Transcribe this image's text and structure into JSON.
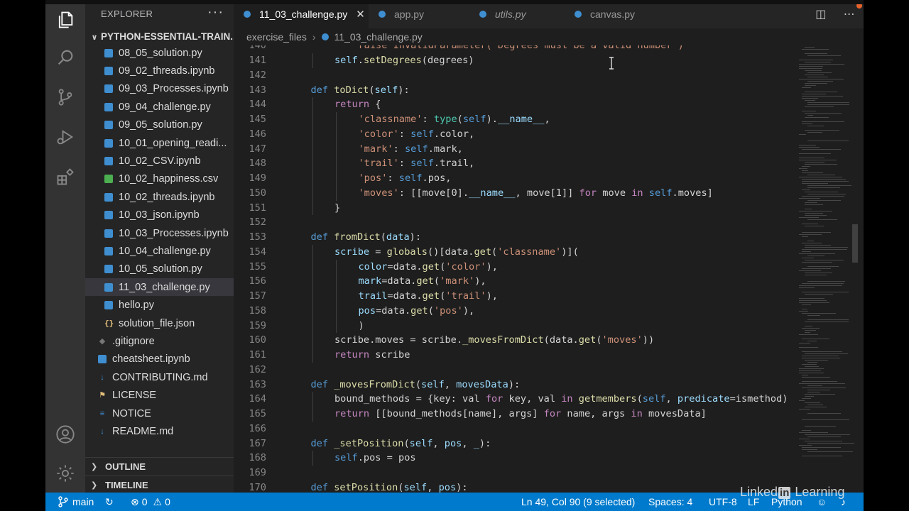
{
  "sidebar": {
    "title": "EXPLORER",
    "more": "···",
    "folder": "PYTHON-ESSENTIAL-TRAIN...",
    "files": [
      {
        "name": "08_05_solution.py",
        "icon": "python-file-icon",
        "level": 1
      },
      {
        "name": "09_02_threads.ipynb",
        "icon": "notebook-file-icon",
        "level": 1
      },
      {
        "name": "09_03_Processes.ipynb",
        "icon": "notebook-file-icon",
        "level": 1
      },
      {
        "name": "09_04_challenge.py",
        "icon": "python-file-icon",
        "level": 1
      },
      {
        "name": "09_05_solution.py",
        "icon": "python-file-icon",
        "level": 1
      },
      {
        "name": "10_01_opening_readi...",
        "icon": "python-file-icon",
        "level": 1
      },
      {
        "name": "10_02_CSV.ipynb",
        "icon": "notebook-file-icon",
        "level": 1
      },
      {
        "name": "10_02_happiness.csv",
        "icon": "csv-file-icon",
        "level": 1
      },
      {
        "name": "10_02_threads.ipynb",
        "icon": "notebook-file-icon",
        "level": 1
      },
      {
        "name": "10_03_json.ipynb",
        "icon": "notebook-file-icon",
        "level": 1
      },
      {
        "name": "10_03_Processes.ipynb",
        "icon": "notebook-file-icon",
        "level": 1
      },
      {
        "name": "10_04_challenge.py",
        "icon": "python-file-icon",
        "level": 1
      },
      {
        "name": "10_05_solution.py",
        "icon": "python-file-icon",
        "level": 1
      },
      {
        "name": "11_03_challenge.py",
        "icon": "python-file-icon",
        "level": 1,
        "selected": true
      },
      {
        "name": "hello.py",
        "icon": "python-file-icon",
        "level": 1
      },
      {
        "name": "solution_file.json",
        "icon": "json-file-icon",
        "level": 1
      },
      {
        "name": ".gitignore",
        "icon": "git-file-icon",
        "level": 2
      },
      {
        "name": "cheatsheet.ipynb",
        "icon": "notebook-file-icon",
        "level": 2
      },
      {
        "name": "CONTRIBUTING.md",
        "icon": "markdown-file-icon",
        "level": 2
      },
      {
        "name": "LICENSE",
        "icon": "license-file-icon",
        "level": 2
      },
      {
        "name": "NOTICE",
        "icon": "text-file-icon",
        "level": 2
      },
      {
        "name": "README.md",
        "icon": "markdown-file-icon",
        "level": 2
      }
    ],
    "outline": "OUTLINE",
    "timeline": "TIMELINE"
  },
  "tabs": [
    {
      "label": "11_03_challenge.py",
      "active": true,
      "close": "✕"
    },
    {
      "label": "app.py",
      "active": false
    },
    {
      "label": "utils.py",
      "active": false,
      "italic": true
    },
    {
      "label": "canvas.py",
      "active": false
    }
  ],
  "breadcrumb": {
    "folder": "exercise_files",
    "separator": "›",
    "file": "11_03_challenge.py"
  },
  "code": {
    "first_partial": {
      "num": "140",
      "text": "raise InvalidParameter('Degrees must be a valid number')"
    },
    "lines": [
      {
        "num": "141",
        "ind": 2,
        "toks": [
          [
            "v",
            "self"
          ],
          [
            "n",
            "."
          ],
          [
            "f",
            "setDegrees"
          ],
          [
            "n",
            "(degrees)"
          ]
        ]
      },
      {
        "num": "142",
        "ind": 0,
        "toks": []
      },
      {
        "num": "143",
        "ind": 1,
        "toks": [
          [
            "k",
            "def "
          ],
          [
            "f",
            "toDict"
          ],
          [
            "n",
            "("
          ],
          [
            "v",
            "self"
          ],
          [
            "n",
            "):"
          ]
        ]
      },
      {
        "num": "144",
        "ind": 2,
        "toks": [
          [
            "ctrl",
            "return"
          ],
          [
            "n",
            " {"
          ]
        ]
      },
      {
        "num": "145",
        "ind": 3,
        "toks": [
          [
            "s",
            "'classname'"
          ],
          [
            "n",
            ": "
          ],
          [
            "b",
            "type"
          ],
          [
            "n",
            "("
          ],
          [
            "k",
            "self"
          ],
          [
            "n",
            ")."
          ],
          [
            "v",
            "__name__"
          ],
          [
            "n",
            ","
          ]
        ]
      },
      {
        "num": "146",
        "ind": 3,
        "toks": [
          [
            "s",
            "'color'"
          ],
          [
            "n",
            ": "
          ],
          [
            "k",
            "self"
          ],
          [
            "n",
            ".color,"
          ]
        ]
      },
      {
        "num": "147",
        "ind": 3,
        "toks": [
          [
            "s",
            "'mark'"
          ],
          [
            "n",
            ": "
          ],
          [
            "k",
            "self"
          ],
          [
            "n",
            ".mark,"
          ]
        ]
      },
      {
        "num": "148",
        "ind": 3,
        "toks": [
          [
            "s",
            "'trail'"
          ],
          [
            "n",
            ": "
          ],
          [
            "k",
            "self"
          ],
          [
            "n",
            ".trail,"
          ]
        ]
      },
      {
        "num": "149",
        "ind": 3,
        "toks": [
          [
            "s",
            "'pos'"
          ],
          [
            "n",
            ": "
          ],
          [
            "k",
            "self"
          ],
          [
            "n",
            ".pos,"
          ]
        ]
      },
      {
        "num": "150",
        "ind": 3,
        "toks": [
          [
            "s",
            "'moves'"
          ],
          [
            "n",
            ": [[move["
          ],
          [
            "n",
            "0"
          ],
          [
            "n",
            "]."
          ],
          [
            "v",
            "__name__"
          ],
          [
            "n",
            ", move[1]] "
          ],
          [
            "ctrl",
            "for"
          ],
          [
            "n",
            " move "
          ],
          [
            "ctrl",
            "in"
          ],
          [
            "n",
            " "
          ],
          [
            "k",
            "self"
          ],
          [
            "n",
            ".moves]"
          ]
        ]
      },
      {
        "num": "151",
        "ind": 2,
        "toks": [
          [
            "n",
            "}"
          ]
        ]
      },
      {
        "num": "152",
        "ind": 0,
        "toks": []
      },
      {
        "num": "153",
        "ind": 1,
        "toks": [
          [
            "k",
            "def "
          ],
          [
            "f",
            "fromDict"
          ],
          [
            "n",
            "("
          ],
          [
            "v",
            "data"
          ],
          [
            "n",
            "):"
          ]
        ]
      },
      {
        "num": "154",
        "ind": 2,
        "toks": [
          [
            "v",
            "scribe"
          ],
          [
            "n",
            " = "
          ],
          [
            "f",
            "globals"
          ],
          [
            "n",
            "()[data."
          ],
          [
            "f",
            "get"
          ],
          [
            "n",
            "("
          ],
          [
            "s",
            "'classname'"
          ],
          [
            "n",
            ")]("
          ]
        ]
      },
      {
        "num": "155",
        "ind": 3,
        "toks": [
          [
            "v",
            "color"
          ],
          [
            "n",
            "=data."
          ],
          [
            "f",
            "get"
          ],
          [
            "n",
            "("
          ],
          [
            "s",
            "'color'"
          ],
          [
            "n",
            "),"
          ]
        ]
      },
      {
        "num": "156",
        "ind": 3,
        "toks": [
          [
            "v",
            "mark"
          ],
          [
            "n",
            "=data."
          ],
          [
            "f",
            "get"
          ],
          [
            "n",
            "("
          ],
          [
            "s",
            "'mark'"
          ],
          [
            "n",
            "),"
          ]
        ]
      },
      {
        "num": "157",
        "ind": 3,
        "toks": [
          [
            "v",
            "trail"
          ],
          [
            "n",
            "=data."
          ],
          [
            "f",
            "get"
          ],
          [
            "n",
            "("
          ],
          [
            "s",
            "'trail'"
          ],
          [
            "n",
            "),"
          ]
        ]
      },
      {
        "num": "158",
        "ind": 3,
        "toks": [
          [
            "v",
            "pos"
          ],
          [
            "n",
            "=data."
          ],
          [
            "f",
            "get"
          ],
          [
            "n",
            "("
          ],
          [
            "s",
            "'pos'"
          ],
          [
            "n",
            "),"
          ]
        ]
      },
      {
        "num": "159",
        "ind": 3,
        "toks": [
          [
            "n",
            ")"
          ]
        ]
      },
      {
        "num": "160",
        "ind": 2,
        "toks": [
          [
            "n",
            "scribe.moves = scribe."
          ],
          [
            "f",
            "_movesFromDict"
          ],
          [
            "n",
            "(data."
          ],
          [
            "f",
            "get"
          ],
          [
            "n",
            "("
          ],
          [
            "s",
            "'moves'"
          ],
          [
            "n",
            "))"
          ]
        ]
      },
      {
        "num": "161",
        "ind": 2,
        "toks": [
          [
            "ctrl",
            "return"
          ],
          [
            "n",
            " scribe"
          ]
        ]
      },
      {
        "num": "162",
        "ind": 0,
        "toks": []
      },
      {
        "num": "163",
        "ind": 1,
        "toks": [
          [
            "k",
            "def "
          ],
          [
            "f",
            "_movesFromDict"
          ],
          [
            "n",
            "("
          ],
          [
            "v",
            "self"
          ],
          [
            "n",
            ", "
          ],
          [
            "v",
            "movesData"
          ],
          [
            "n",
            "):"
          ]
        ]
      },
      {
        "num": "164",
        "ind": 2,
        "toks": [
          [
            "n",
            "bound_methods = {key: val "
          ],
          [
            "ctrl",
            "for"
          ],
          [
            "n",
            " key, val "
          ],
          [
            "ctrl",
            "in"
          ],
          [
            "n",
            " "
          ],
          [
            "f",
            "getmembers"
          ],
          [
            "n",
            "("
          ],
          [
            "k",
            "self"
          ],
          [
            "n",
            ", "
          ],
          [
            "v",
            "predicate"
          ],
          [
            "n",
            "=ismethod)"
          ]
        ]
      },
      {
        "num": "165",
        "ind": 2,
        "toks": [
          [
            "ctrl",
            "return"
          ],
          [
            "n",
            " [[bound_methods[name], args] "
          ],
          [
            "ctrl",
            "for"
          ],
          [
            "n",
            " name, args "
          ],
          [
            "ctrl",
            "in"
          ],
          [
            "n",
            " movesData]"
          ]
        ]
      },
      {
        "num": "166",
        "ind": 0,
        "toks": []
      },
      {
        "num": "167",
        "ind": 1,
        "toks": [
          [
            "k",
            "def "
          ],
          [
            "f",
            "_setPosition"
          ],
          [
            "n",
            "("
          ],
          [
            "v",
            "self"
          ],
          [
            "n",
            ", "
          ],
          [
            "v",
            "pos"
          ],
          [
            "n",
            ", "
          ],
          [
            "v",
            "_"
          ],
          [
            "n",
            "):"
          ]
        ]
      },
      {
        "num": "168",
        "ind": 2,
        "toks": [
          [
            "k",
            "self"
          ],
          [
            "n",
            ".pos = pos"
          ]
        ]
      },
      {
        "num": "169",
        "ind": 0,
        "toks": []
      },
      {
        "num": "170",
        "ind": 1,
        "toks": [
          [
            "k",
            "def "
          ],
          [
            "f",
            "setPosition"
          ],
          [
            "n",
            "("
          ],
          [
            "v",
            "self"
          ],
          [
            "n",
            ", "
          ],
          [
            "v",
            "pos"
          ],
          [
            "n",
            "):"
          ]
        ]
      }
    ]
  },
  "status": {
    "branch": "main",
    "errors": "0",
    "warnings": "0",
    "position": "Ln 49, Col 90 (9 selected)",
    "spaces": "Spaces: 4",
    "encoding": "UTF-8",
    "eol": "LF",
    "language": "Python"
  },
  "watermark": {
    "pre": "Linked",
    "mid": "in",
    "post": " Learning"
  },
  "colors": {
    "accent": "#007acc",
    "sidebar": "#252526",
    "editor": "#1e1e1e",
    "activity": "#333333"
  }
}
